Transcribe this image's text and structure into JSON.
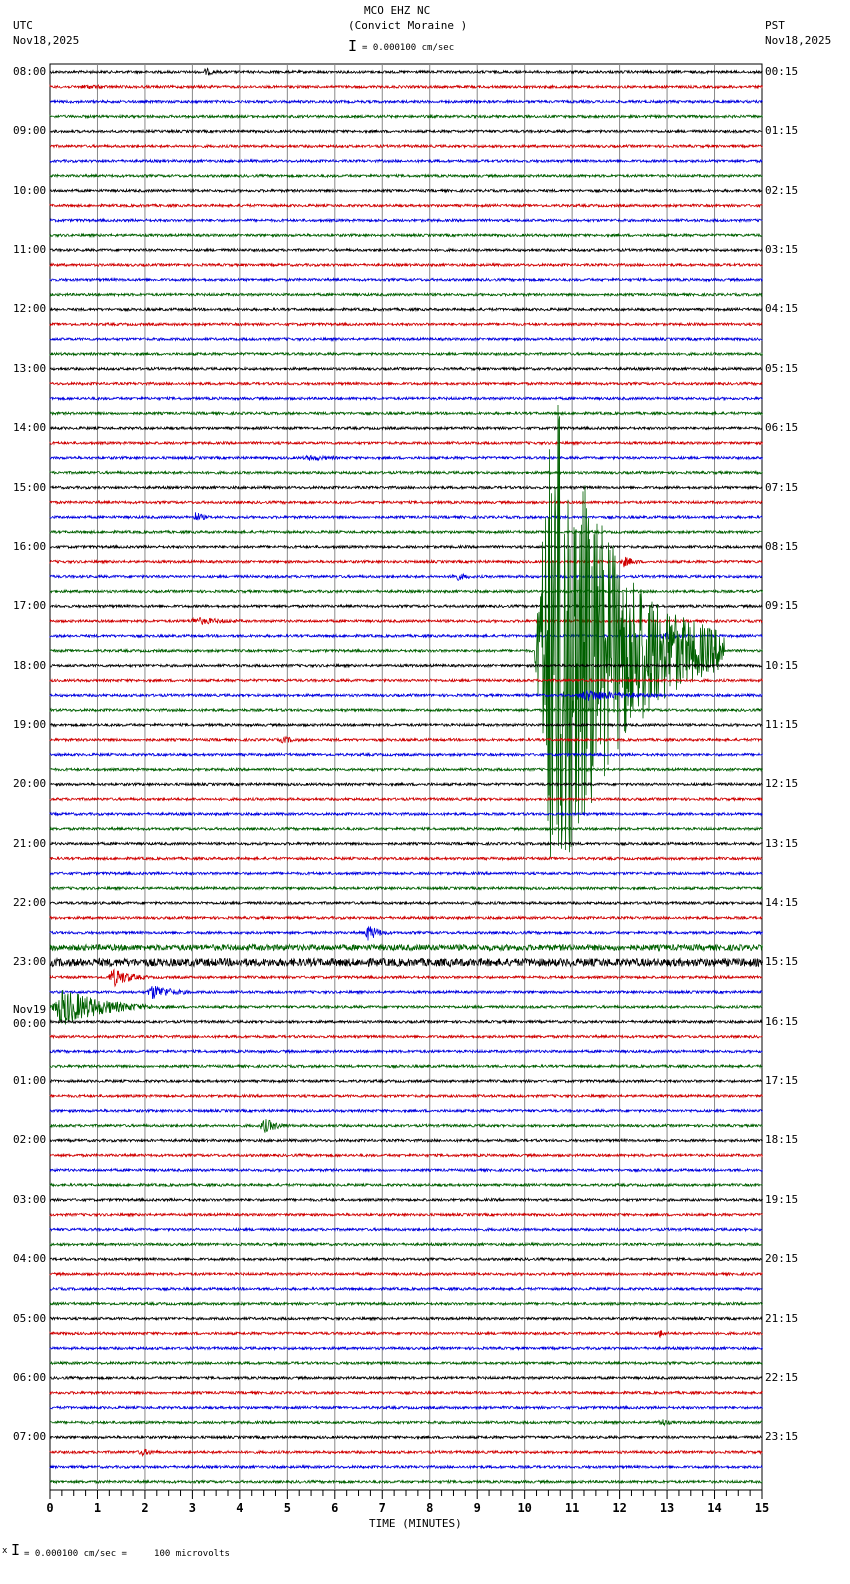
{
  "header": {
    "station": "MCO EHZ NC",
    "location": "(Convict Moraine )",
    "scale": "= 0.000100 cm/sec",
    "left_tz": "UTC",
    "left_date": "Nov18,2025",
    "right_tz": "PST",
    "right_date": "Nov18,2025"
  },
  "footer": {
    "scale_note": "= 0.000100 cm/sec =     100 microvolts"
  },
  "chart_data": {
    "type": "line",
    "title": "MCO EHZ NC (Convict Moraine )",
    "xlabel": "TIME (MINUTES)",
    "xlim": [
      0,
      15
    ],
    "x_ticks": [
      "0",
      "1",
      "2",
      "3",
      "4",
      "5",
      "6",
      "7",
      "8",
      "9",
      "10",
      "11",
      "12",
      "13",
      "14",
      "15"
    ],
    "trace_colors": [
      "#000000",
      "#d00000",
      "#0000e0",
      "#006000"
    ],
    "rows_per_hour": 4,
    "utc_labels": [
      "08:00",
      "09:00",
      "10:00",
      "11:00",
      "12:00",
      "13:00",
      "14:00",
      "15:00",
      "16:00",
      "17:00",
      "18:00",
      "19:00",
      "20:00",
      "21:00",
      "22:00",
      "23:00",
      "00:00",
      "01:00",
      "02:00",
      "03:00",
      "04:00",
      "05:00",
      "06:00",
      "07:00"
    ],
    "date_change": {
      "hour_index": 16,
      "label": "Nov19"
    },
    "pst_labels": [
      "00:15",
      "01:15",
      "02:15",
      "03:15",
      "04:15",
      "05:15",
      "06:15",
      "07:15",
      "08:15",
      "09:15",
      "10:15",
      "11:15",
      "12:15",
      "13:15",
      "14:15",
      "15:15",
      "16:15",
      "17:15",
      "18:15",
      "19:15",
      "20:15",
      "21:15",
      "22:15",
      "23:15"
    ],
    "events": [
      {
        "row": 0,
        "start_min": 3.2,
        "duration_min": 0.8,
        "amplitude": 4
      },
      {
        "row": 1,
        "start_min": 0.5,
        "duration_min": 2.5,
        "amplitude": 2.5
      },
      {
        "row": 26,
        "start_min": 5.2,
        "duration_min": 2.5,
        "amplitude": 3
      },
      {
        "row": 30,
        "start_min": 3.0,
        "duration_min": 0.6,
        "amplitude": 6
      },
      {
        "row": 33,
        "start_min": 12.0,
        "duration_min": 0.8,
        "amplitude": 6
      },
      {
        "row": 34,
        "start_min": 8.4,
        "duration_min": 1.0,
        "amplitude": 5
      },
      {
        "row": 37,
        "start_min": 2.8,
        "duration_min": 2.8,
        "amplitude": 4
      },
      {
        "row": 38,
        "start_min": 12.8,
        "duration_min": 1.5,
        "amplitude": 4
      },
      {
        "row": 39,
        "start_min": 10.2,
        "duration_min": 4.0,
        "amplitude": 280
      },
      {
        "row": 42,
        "start_min": 11.0,
        "duration_min": 3.2,
        "amplitude": 6
      },
      {
        "row": 45,
        "start_min": 4.8,
        "duration_min": 1.0,
        "amplitude": 4
      },
      {
        "row": 58,
        "start_min": 6.6,
        "duration_min": 0.8,
        "amplitude": 9
      },
      {
        "row": 59,
        "start_min": 0,
        "duration_min": 15,
        "amplitude": 3
      },
      {
        "row": 60,
        "start_min": 0,
        "duration_min": 15,
        "amplitude": 4
      },
      {
        "row": 61,
        "start_min": 1.2,
        "duration_min": 1.2,
        "amplitude": 10
      },
      {
        "row": 62,
        "start_min": 2.0,
        "duration_min": 1.5,
        "amplitude": 8
      },
      {
        "row": 63,
        "start_min": 0,
        "duration_min": 2.6,
        "amplitude": 20
      },
      {
        "row": 71,
        "start_min": 4.4,
        "duration_min": 1.0,
        "amplitude": 8
      },
      {
        "row": 85,
        "start_min": 12.8,
        "duration_min": 0.4,
        "amplitude": 5
      },
      {
        "row": 91,
        "start_min": 12.8,
        "duration_min": 0.6,
        "amplitude": 5
      },
      {
        "row": 93,
        "start_min": 1.8,
        "duration_min": 1.2,
        "amplitude": 4
      }
    ]
  }
}
